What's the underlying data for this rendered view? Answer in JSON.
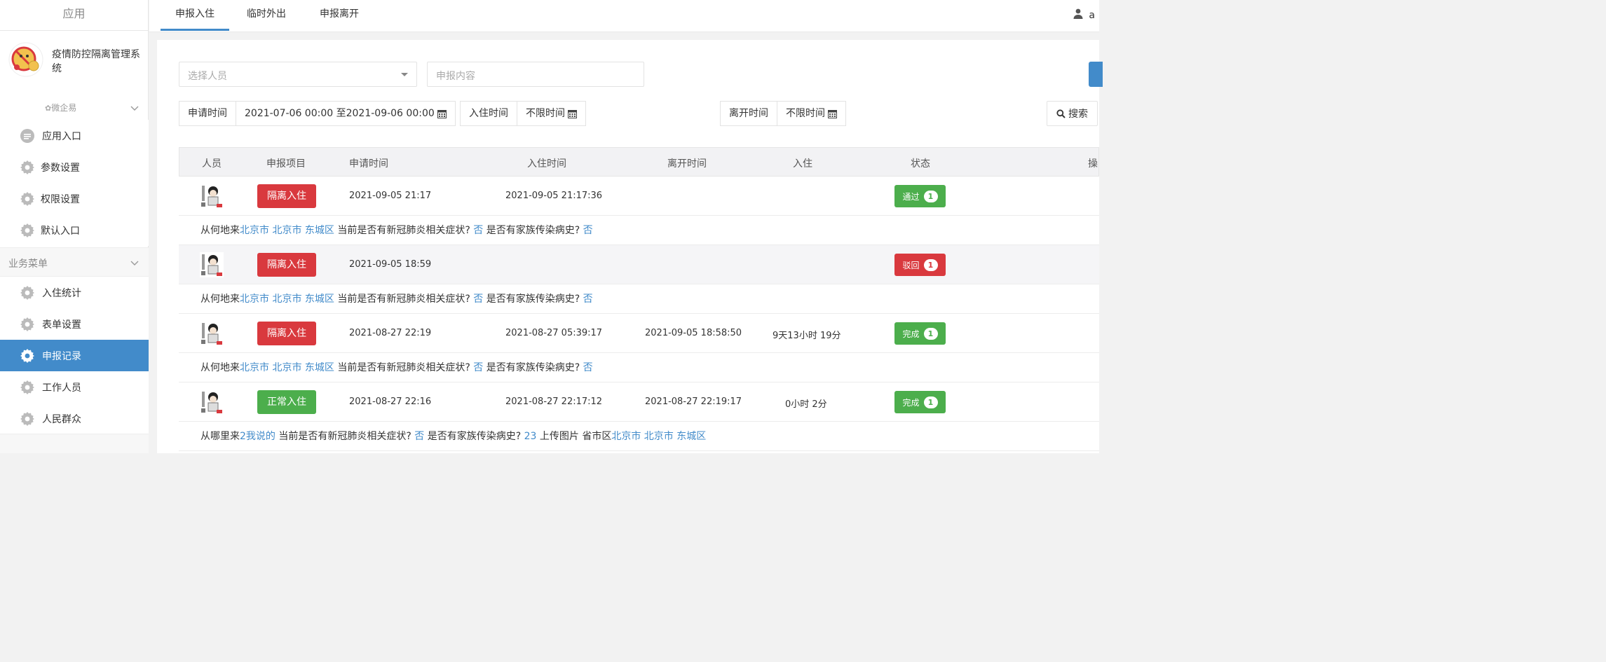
{
  "sidebar": {
    "header": "应用",
    "app_name": "疫情防控隔离管理系统",
    "org_label": "微企易",
    "menu_top": [
      {
        "label": "应用入口",
        "icon": "chat-icon"
      },
      {
        "label": "参数设置",
        "icon": "gear-icon"
      },
      {
        "label": "权限设置",
        "icon": "gear-icon"
      },
      {
        "label": "默认入口",
        "icon": "gear-icon"
      }
    ],
    "section_title": "业务菜单",
    "menu_business": [
      {
        "label": "入住统计",
        "icon": "gear-icon",
        "active": false
      },
      {
        "label": "表单设置",
        "icon": "gear-icon",
        "active": false
      },
      {
        "label": "申报记录",
        "icon": "gear-icon",
        "active": true
      },
      {
        "label": "工作人员",
        "icon": "gear-icon",
        "active": false
      },
      {
        "label": "人民群众",
        "icon": "gear-icon",
        "active": false
      }
    ]
  },
  "topbar": {
    "tabs": [
      {
        "label": "申报入住",
        "active": true
      },
      {
        "label": "临时外出",
        "active": false
      },
      {
        "label": "申报离开",
        "active": false
      }
    ],
    "user_initial": "a"
  },
  "filters": {
    "person_placeholder": "选择人员",
    "content_placeholder": "申报内容",
    "apply_time_label": "申请时间",
    "apply_time_value": "2021-07-06 00:00 至2021-09-06 00:00",
    "checkin_time_label": "入住时间",
    "checkin_time_value": "不限时间",
    "leave_time_label": "离开时间",
    "leave_time_value": "不限时间",
    "search_label": "搜索"
  },
  "table": {
    "headers": [
      "人员",
      "申报项目",
      "申请时间",
      "入住时间",
      "离开时间",
      "入住",
      "状态",
      "操"
    ],
    "rows": [
      {
        "project": "隔离入住",
        "project_color": "#d9393e",
        "apply_time": "2021-09-05 21:17",
        "checkin_time": "2021-09-05 21:17:36",
        "leave_time": "",
        "duration": "",
        "status": "通过",
        "status_color": "#4cae4c",
        "badge": "1",
        "detail": [
          {
            "t": "从何地来",
            "link": false
          },
          {
            "t": "北京市 北京市 东城区",
            "link": true
          },
          {
            "t": " 当前是否有新冠肺炎相关症状? ",
            "link": false
          },
          {
            "t": "否",
            "link": true
          },
          {
            "t": " 是否有家族传染病史? ",
            "link": false
          },
          {
            "t": "否",
            "link": true
          }
        ]
      },
      {
        "project": "隔离入住",
        "project_color": "#d9393e",
        "apply_time": "2021-09-05 18:59",
        "checkin_time": "",
        "leave_time": "",
        "duration": "",
        "status": "驳回",
        "status_color": "#d9393e",
        "badge": "1",
        "detail": [
          {
            "t": "从何地来",
            "link": false
          },
          {
            "t": "北京市 北京市 东城区",
            "link": true
          },
          {
            "t": " 当前是否有新冠肺炎相关症状? ",
            "link": false
          },
          {
            "t": "否",
            "link": true
          },
          {
            "t": " 是否有家族传染病史? ",
            "link": false
          },
          {
            "t": "否",
            "link": true
          }
        ]
      },
      {
        "project": "隔离入住",
        "project_color": "#d9393e",
        "apply_time": "2021-08-27 22:19",
        "checkin_time": "2021-08-27 05:39:17",
        "leave_time": "2021-09-05 18:58:50",
        "duration": "9天13小时 19分",
        "status": "完成",
        "status_color": "#4cae4c",
        "badge": "1",
        "detail": [
          {
            "t": "从何地来",
            "link": false
          },
          {
            "t": "北京市 北京市 东城区",
            "link": true
          },
          {
            "t": " 当前是否有新冠肺炎相关症状? ",
            "link": false
          },
          {
            "t": "否",
            "link": true
          },
          {
            "t": " 是否有家族传染病史? ",
            "link": false
          },
          {
            "t": "否",
            "link": true
          }
        ]
      },
      {
        "project": "正常入住",
        "project_color": "#4cae4c",
        "apply_time": "2021-08-27 22:16",
        "checkin_time": "2021-08-27 22:17:12",
        "leave_time": "2021-08-27 22:19:17",
        "duration": "0小时 2分",
        "status": "完成",
        "status_color": "#4cae4c",
        "badge": "1",
        "detail": [
          {
            "t": "从哪里来",
            "link": false
          },
          {
            "t": "2我说的",
            "link": true
          },
          {
            "t": " 当前是否有新冠肺炎相关症状? ",
            "link": false
          },
          {
            "t": "否",
            "link": true
          },
          {
            "t": " 是否有家族传染病史? ",
            "link": false
          },
          {
            "t": "23",
            "link": true
          },
          {
            "t": " 上传图片 省市区",
            "link": false
          },
          {
            "t": "北京市 北京市 东城区",
            "link": true
          }
        ]
      }
    ]
  },
  "colors": {
    "primary": "#428bca",
    "danger": "#d9393e",
    "success": "#4cae4c",
    "link": "#428bca"
  }
}
